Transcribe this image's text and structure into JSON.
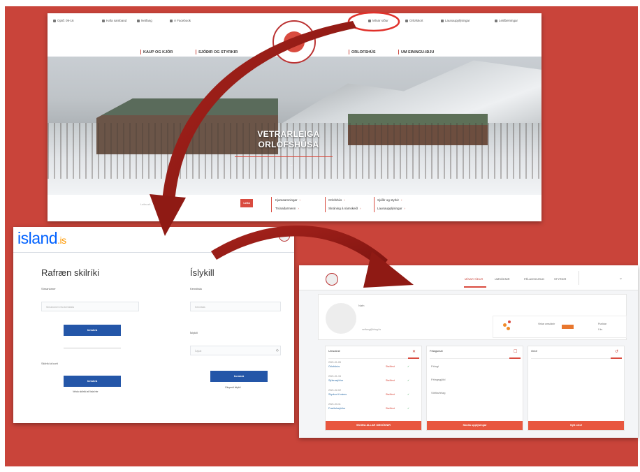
{
  "colors": {
    "background": "#c9443a",
    "accent": "#d94b3f",
    "island_blue": "#0061ff",
    "login_button": "#2456a8",
    "dashboard_button": "#e8573f"
  },
  "website": {
    "topbar": [
      "Opið: 09-16",
      "Hafa samband",
      "Netfang",
      "Á Facebook",
      "Mínar síður",
      "Orlofskort",
      "Launaupplýsingar",
      "Leiðbeiningar"
    ],
    "nav_left": [
      "KAUP OG KJÖR",
      "SJÓÐIR OG STYRKIR"
    ],
    "nav_right": [
      "ORLOFSHÚS",
      "UM EININGU-IÐJU"
    ],
    "hero_title_line1": "VETRARLEIGA",
    "hero_title_line2": "ORLOFSHÚSA",
    "hero_arrow": "→",
    "search_placeholder": "Leita að...",
    "search_button": "Leita",
    "quick_links": {
      "col1": [
        "Kjarasamningar",
        "Trúnaðarmenn"
      ],
      "col2": [
        "Orlofshús",
        "Skráning á námskeið"
      ],
      "col3": [
        "Sjóðir og styrkir",
        "Launaupplýsingar"
      ]
    },
    "logo_icon": "union-logo"
  },
  "login": {
    "brand": "island",
    "brand_suffix": ".is",
    "left_title": "Rafræn skilríki",
    "right_title": "Íslykill",
    "phone_label": "Símanúmer",
    "phone_placeholder": "Símanúmer eða kennitala",
    "login_button_left": "Innskrá",
    "card_label": "Skilríki á korti",
    "card_button": "Innskrá",
    "card_note": "Veldu skilríki af lista hér",
    "ssn_label": "Kennitala",
    "ssn_placeholder": "Kennitala",
    "password_label": "Íslykill",
    "password_placeholder": "Íslykill",
    "password_toggle": "◇",
    "right_button": "Innskrá",
    "forgot": "Gleymdi Íslykli"
  },
  "dashboard": {
    "menu": [
      "MÍNAR SÍÐUR",
      "UMSÓKNIR",
      "FÉLAGSGJÖLD",
      "STYRKIR"
    ],
    "active_menu": 0,
    "profile_name": "Nafn",
    "profile_email": "netfang@felagi.is",
    "stat1_label": "Virkar umsóknir",
    "stat2_label": "Punktar",
    "stat2_value": "0 kr.",
    "cards": [
      {
        "title": "Umsóknir",
        "icon": "✕",
        "button": "SKOÐA ALLAR UMSÓKNIR",
        "rows": [
          {
            "date": "2021-01-05",
            "title": "Orlofshús",
            "status": "Staðfest"
          },
          {
            "date": "2021-01-15",
            "title": "Sjúkrasjóður",
            "status": "Staðfest"
          },
          {
            "date": "2021-02-02",
            "title": "Styrkur til náms",
            "status": "Staðfest"
          },
          {
            "date": "2021-03-11",
            "title": "Fræðslusjóður",
            "status": "Staðfest"
          }
        ]
      },
      {
        "title": "Félagsmál",
        "icon": "☐",
        "button": "Skoða upplýsingar",
        "items": [
          "Félagi",
          "Félagsgjöld",
          "Stéttarfélag"
        ]
      },
      {
        "title": "Orlof",
        "icon": "↺",
        "button": "Nýtt orlof",
        "items": []
      }
    ],
    "check_icon": "✓"
  }
}
